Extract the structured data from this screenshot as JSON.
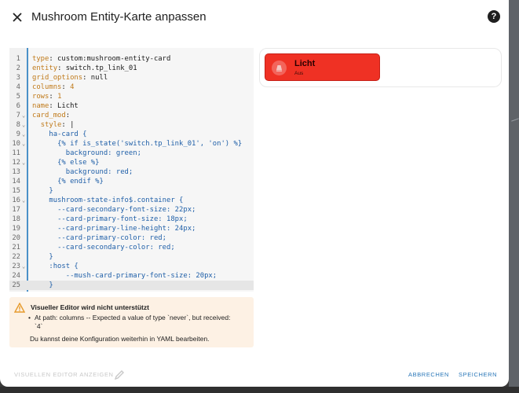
{
  "dialog": {
    "title": "Mushroom Entity-Karte anpassen",
    "help_label": "?"
  },
  "editor": {
    "lines": [
      {
        "n": "1",
        "parts": [
          [
            "k",
            "type"
          ],
          [
            "v",
            ": custom:mushroom-entity-card"
          ]
        ]
      },
      {
        "n": "2",
        "parts": [
          [
            "k",
            "entity"
          ],
          [
            "v",
            ": switch.tp_link_01"
          ]
        ]
      },
      {
        "n": "3",
        "parts": [
          [
            "k",
            "grid_options"
          ],
          [
            "v",
            ": null"
          ]
        ]
      },
      {
        "n": "4",
        "parts": [
          [
            "k",
            "columns"
          ],
          [
            "v",
            ": "
          ],
          [
            "n",
            "4"
          ]
        ]
      },
      {
        "n": "5",
        "parts": [
          [
            "k",
            "rows"
          ],
          [
            "v",
            ": "
          ],
          [
            "n",
            "1"
          ]
        ]
      },
      {
        "n": "6",
        "parts": [
          [
            "k",
            "name"
          ],
          [
            "v",
            ": Licht"
          ]
        ]
      },
      {
        "n": "7",
        "fold": true,
        "parts": [
          [
            "k",
            "card_mod"
          ],
          [
            "v",
            ":"
          ]
        ]
      },
      {
        "n": "8",
        "fold": true,
        "parts": [
          [
            "v",
            "  "
          ],
          [
            "k",
            "style"
          ],
          [
            "v",
            ": |"
          ]
        ]
      },
      {
        "n": "9",
        "fold": true,
        "parts": [
          [
            "v",
            "    "
          ],
          [
            "b",
            "ha-card {"
          ]
        ]
      },
      {
        "n": "10",
        "fold": true,
        "parts": [
          [
            "v",
            "      "
          ],
          [
            "b",
            "{% if is_state('switch.tp_link_01', 'on') %}"
          ]
        ]
      },
      {
        "n": "11",
        "parts": [
          [
            "v",
            "        "
          ],
          [
            "b",
            "background: green;"
          ]
        ]
      },
      {
        "n": "12",
        "fold": true,
        "parts": [
          [
            "v",
            "      "
          ],
          [
            "b",
            "{% else %}"
          ]
        ]
      },
      {
        "n": "13",
        "parts": [
          [
            "v",
            "        "
          ],
          [
            "b",
            "background: red;"
          ]
        ]
      },
      {
        "n": "14",
        "parts": [
          [
            "v",
            "      "
          ],
          [
            "b",
            "{% endif %}"
          ]
        ]
      },
      {
        "n": "15",
        "parts": [
          [
            "v",
            "    "
          ],
          [
            "b",
            "}"
          ]
        ]
      },
      {
        "n": "16",
        "fold": true,
        "parts": [
          [
            "v",
            "    "
          ],
          [
            "b",
            "mushroom-state-info$.container {"
          ]
        ]
      },
      {
        "n": "17",
        "parts": [
          [
            "v",
            "      "
          ],
          [
            "b",
            "--card-secondary-font-size: 22px;"
          ]
        ]
      },
      {
        "n": "18",
        "parts": [
          [
            "v",
            "      "
          ],
          [
            "b",
            "--card-primary-font-size: 18px;"
          ]
        ]
      },
      {
        "n": "19",
        "parts": [
          [
            "v",
            "      "
          ],
          [
            "b",
            "--card-primary-line-height: 24px;"
          ]
        ]
      },
      {
        "n": "20",
        "parts": [
          [
            "v",
            "      "
          ],
          [
            "b",
            "--card-primary-color: red;"
          ]
        ]
      },
      {
        "n": "21",
        "parts": [
          [
            "v",
            "      "
          ],
          [
            "b",
            "--card-secondary-color: red;"
          ]
        ]
      },
      {
        "n": "22",
        "parts": [
          [
            "v",
            "    "
          ],
          [
            "b",
            "}"
          ]
        ]
      },
      {
        "n": "23",
        "fold": true,
        "parts": [
          [
            "v",
            "    "
          ],
          [
            "b",
            ":host {"
          ]
        ]
      },
      {
        "n": "24",
        "parts": [
          [
            "v",
            "      "
          ],
          [
            "b",
            "  --mush-card-primary-font-size: 20px;"
          ]
        ]
      },
      {
        "n": "25",
        "active": true,
        "parts": [
          [
            "v",
            "    "
          ],
          [
            "b",
            "}"
          ]
        ]
      }
    ]
  },
  "warning": {
    "title": "Visueller Editor wird nicht unterstützt",
    "bullet": "At path: columns -- Expected a value of type `never`, but received: `4`",
    "footer": "Du kannst deine Konfiguration weiterhin in YAML bearbeiten."
  },
  "preview": {
    "name": "Licht",
    "state": "Aus",
    "icon": "lamp-icon",
    "card_color": "#ef3124"
  },
  "footer": {
    "visual_editor_label": "VISUELLEN EDITOR ANZEIGEN",
    "cancel_label": "ABBRECHEN",
    "save_label": "SPEICHERN"
  },
  "colors": {
    "accent": "#2b78b9",
    "yaml_key": "#c07a1a",
    "yaml_string": "#1f5fa8",
    "warning_bg": "#fdf1e4"
  }
}
